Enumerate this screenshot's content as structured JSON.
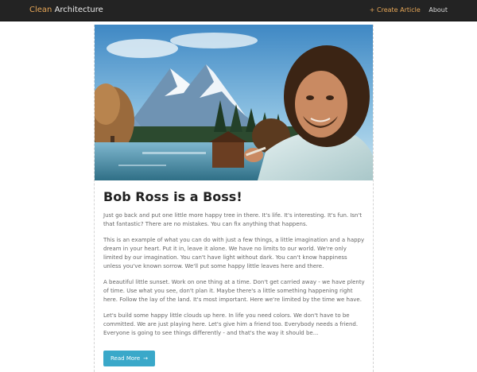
{
  "navbar": {
    "brand_part1": "Clean",
    "brand_part2": " Architecture",
    "create_label": "+ Create Article",
    "about_label": "About"
  },
  "article": {
    "title": "Bob Ross is a Boss!",
    "paragraphs": [
      "Just go back and put one little more happy tree in there. It's life. It's interesting. It's fun. Isn't that fantastic? There are no mistakes. You can fix anything that happens.",
      "This is an example of what you can do with just a few things, a little imagination and a happy dream in your heart. Put it in, leave it alone. We have no limits to our world. We're only limited by our imagination. You can't have light without dark. You can't know happiness unless you've known sorrow. We'll put some happy little leaves here and there.",
      "A beautiful little sunset. Work on one thing at a time. Don't get carried away - we have plenty of time. Use what you see, don't plan it. Maybe there's a little something happening right here. Follow the lay of the land. It's most important. Here we're limited by the time we have.",
      "Let's build some happy little clouds up here. In life you need colors. We don't have to be committed. We are just playing here. Let's give him a friend too. Everybody needs a friend. Everyone is going to see things differently - and that's the way it should be..."
    ],
    "read_more_label": "Read More",
    "read_more_icon": "→"
  },
  "colors": {
    "navbar_bg": "#232323",
    "brand_accent": "#e6a657",
    "button_bg": "#3aa8c9"
  }
}
